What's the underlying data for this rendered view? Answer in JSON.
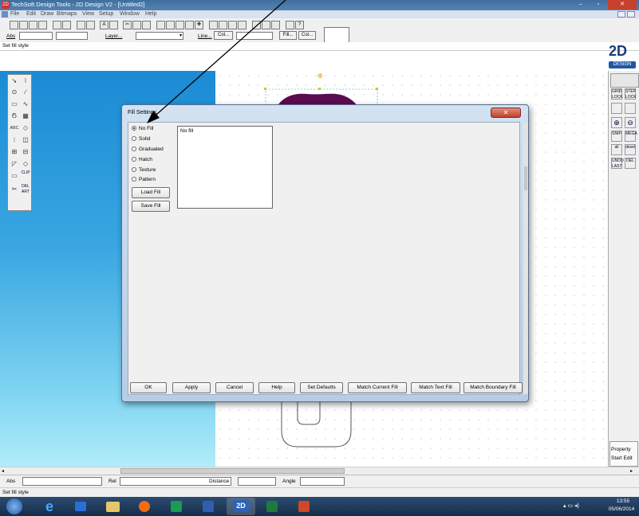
{
  "window": {
    "title": "TechSoft Design Tools - 2D Design V2 - [Untitled2]",
    "minimize": "–",
    "restore": "▫",
    "close": "✕"
  },
  "menu": [
    "File",
    "Edit",
    "Draw",
    "Bitmaps",
    "View",
    "Setup",
    "Window",
    "Help"
  ],
  "toolbar": {
    "abs_label": "Abs",
    "layer_label": "Layer...",
    "line_label": "Line...",
    "col_label": "Col...",
    "fill_label": "Fill...",
    "col2_label": "Col..."
  },
  "status_top": "Set fill style",
  "logo": {
    "text": "2D",
    "sub": "DESIGN"
  },
  "right_tools": [
    "GRID LOCK",
    "STEP LOCK",
    "SNIP",
    "MEGA",
    "all",
    "desel",
    "UNDO LAST",
    "DEL"
  ],
  "right_bottom": {
    "property": "Property",
    "start_edit": "Start Edit"
  },
  "left_tools": {
    "abc": "ABC",
    "clip": "CLIP",
    "del": "DEL ART"
  },
  "dialog": {
    "title": "Fill Settings",
    "options": [
      {
        "label": "No Fill",
        "selected": true
      },
      {
        "label": "Solid",
        "selected": false
      },
      {
        "label": "Graduated",
        "selected": false
      },
      {
        "label": "Hatch",
        "selected": false
      },
      {
        "label": "Texture",
        "selected": false
      },
      {
        "label": "Pattern",
        "selected": false
      }
    ],
    "load_fill": "Load Fill",
    "save_fill": "Save Fill",
    "preview_text": "No fill",
    "buttons": [
      "OK",
      "Apply",
      "Cancel",
      "Help",
      "Set Defaults",
      "Match Current Fill",
      "Match Text Fill",
      "Match Boundary Fill"
    ]
  },
  "coords": {
    "abs": "Abs",
    "rel": "Rel",
    "distance": "Distance",
    "angle": "Angle"
  },
  "status_bottom": "Set fill style",
  "tray": {
    "time": "13:55",
    "date": "05/06/2014"
  },
  "colors": {
    "accent": "#1a8bd4",
    "shape_fill": "#5b0b50",
    "dialog_frame": "#b7cde6"
  }
}
